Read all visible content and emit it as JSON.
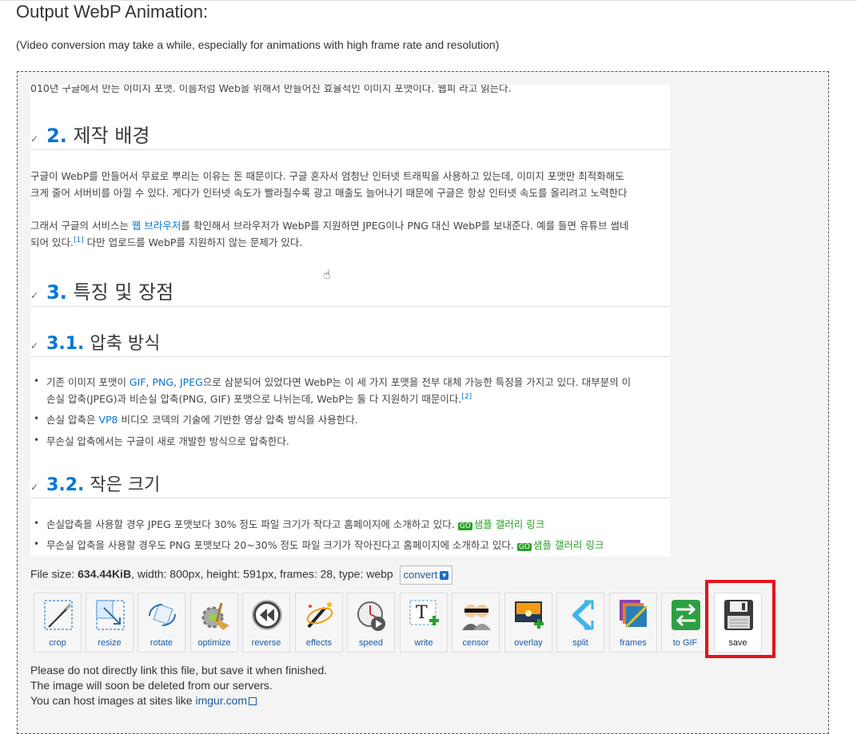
{
  "page": {
    "title": "Output WebP Animation:",
    "subtitle": "(Video conversion may take a while, especially for animations with high frame rate and resolution)"
  },
  "preview": {
    "top_fragment": "010년 구글에서 만든 이미지 포맷. 이름처럼 Web을 위해서 만들어진 효율적인 이미지 포맷이다. 웹피 라고 읽는다.",
    "h2_1_num": "2.",
    "h2_1_text": "제작 배경",
    "p1_l1": "구글이 WebP를 만들어서 무료로 뿌리는 이유는 돈 때문이다. 구글 혼자서 엄청난 인터넷 트래픽을 사용하고 있는데, 이미지 포맷만 최적화해도",
    "p1_l2": "크게 줄어 서버비를 아낄 수 있다. 게다가 인터넷 속도가 빨라질수록 광고 매출도 늘어나기 때문에 구글은 항상 인터넷 속도를 올리려고 노력한다",
    "p2_l1_a": "그래서 구글의 서비스는 ",
    "p2_l1_link": "웹 브라우저",
    "p2_l1_b": "를 확인해서 브라우저가 WebP를 지원하면 JPEG이나 PNG 대신 WebP를 보내준다. 예를 들면 유튜브 썸네",
    "p2_l2_a": "되어 있다.",
    "p2_l2_ref": "[1]",
    "p2_l2_b": " 다만 업로드를 WebP를 지원하지 않는 문제가 있다.",
    "h2_2_num": "3.",
    "h2_2_text": "특징 및 장점",
    "h3_1_num": "3.1.",
    "h3_1_text": "압축 방식",
    "b1_l1_a": "기존 이미지 포맷이 ",
    "b1_l1_gif": "GIF",
    "b1_l1_png": "PNG",
    "b1_l1_jpeg": "JPEG",
    "b1_l1_b": "으로 삼분되어 있었다면 WebP는 이 세 가지 포맷을 전부 대체 가능한 특징을 가지고 있다. 대부분의 이",
    "b1_l2_a": "손실 압축(JPEG)과 비손실 압축(PNG, GIF) 포맷으로 나뉘는데, WebP는 둘 다 지원하기 때문이다.",
    "b1_l2_ref": "[2]",
    "b2_a": "손실 압축은 ",
    "b2_link": "VP8",
    "b2_b": " 비디오 코덱의 기술에 기반한 영상 압축 방식을 사용한다.",
    "b3": "무손실 압축에서는 구글이 새로 개발한 방식으로 압축한다.",
    "h3_2_num": "3.2.",
    "h3_2_text": "작은 크기",
    "b4_a": "손실압축을 사용할 경우 JPEG 포맷보다 30% 정도 파일 크기가 작다고 홈페이지에 소개하고 있다. ",
    "b4_link": "샘플 갤러리 링크",
    "b5_a": "무손실 압축을 사용할 경우도 PNG 포맷보다 20~30% 정도 파일 크기가 작아진다고 홈페이지에 소개하고 있다. ",
    "b5_link": "샘플 갤러리 링크",
    "badge": "GO"
  },
  "info": {
    "prefix": "File size: ",
    "size": "634.44KiB",
    "rest": ", width: 800px, height: 591px, frames: 28, type: webp",
    "convert_label": "convert"
  },
  "toolbar": [
    {
      "label": "crop",
      "icon": "crop-icon"
    },
    {
      "label": "resize",
      "icon": "resize-icon"
    },
    {
      "label": "rotate",
      "icon": "rotate-icon"
    },
    {
      "label": "optimize",
      "icon": "optimize-icon"
    },
    {
      "label": "reverse",
      "icon": "reverse-icon"
    },
    {
      "label": "effects",
      "icon": "effects-icon"
    },
    {
      "label": "speed",
      "icon": "speed-icon"
    },
    {
      "label": "write",
      "icon": "write-icon"
    },
    {
      "label": "censor",
      "icon": "censor-icon"
    },
    {
      "label": "overlay",
      "icon": "overlay-icon"
    },
    {
      "label": "split",
      "icon": "split-icon"
    },
    {
      "label": "frames",
      "icon": "frames-icon"
    },
    {
      "label": "to GIF",
      "icon": "to-gif-icon"
    },
    {
      "label": "save",
      "icon": "save-icon"
    }
  ],
  "notes": {
    "line1": "Please do not directly link this file, but save it when finished.",
    "line2": "The image will soon be deleted from our servers.",
    "line3_prefix": "You can host images at sites like ",
    "line3_link": "imgur.com"
  },
  "colors": {
    "highlight": "#e3141c",
    "link": "#1a5aa6",
    "accent_blue": "#0275d8",
    "accent_green": "#28a028"
  }
}
